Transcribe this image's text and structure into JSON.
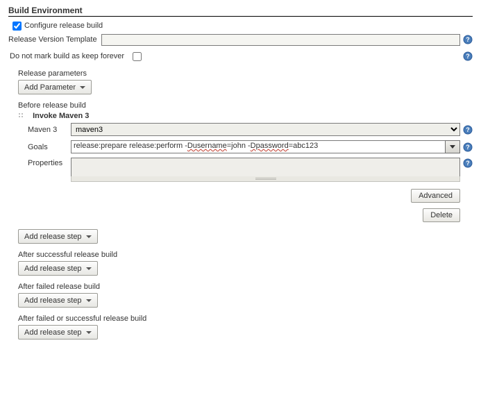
{
  "section": {
    "title": "Build Environment"
  },
  "configure": {
    "checkbox_label": "Configure release build",
    "checked": true
  },
  "releaseVersion": {
    "label": "Release Version Template",
    "value": ""
  },
  "keepForever": {
    "label": "Do not mark build as keep forever",
    "checked": false
  },
  "releaseParams": {
    "heading": "Release parameters",
    "button": "Add Parameter"
  },
  "beforeRelease": {
    "heading": "Before release build",
    "step_title": "Invoke Maven 3",
    "maven": {
      "label": "Maven 3",
      "selected": "maven3"
    },
    "goals": {
      "label": "Goals",
      "value_pre": "release:prepare release:perform -",
      "value_w1": "Dusername",
      "value_mid": "=john -",
      "value_w2": "Dpassword",
      "value_post": "=abc123"
    },
    "properties": {
      "label": "Properties",
      "value": ""
    },
    "advanced": "Advanced",
    "delete": "Delete"
  },
  "addStep": {
    "label": "Add release step"
  },
  "afterSuccess": {
    "heading": "After successful release build"
  },
  "afterFailed": {
    "heading": "After failed release build"
  },
  "afterAny": {
    "heading": "After failed or successful release build"
  }
}
